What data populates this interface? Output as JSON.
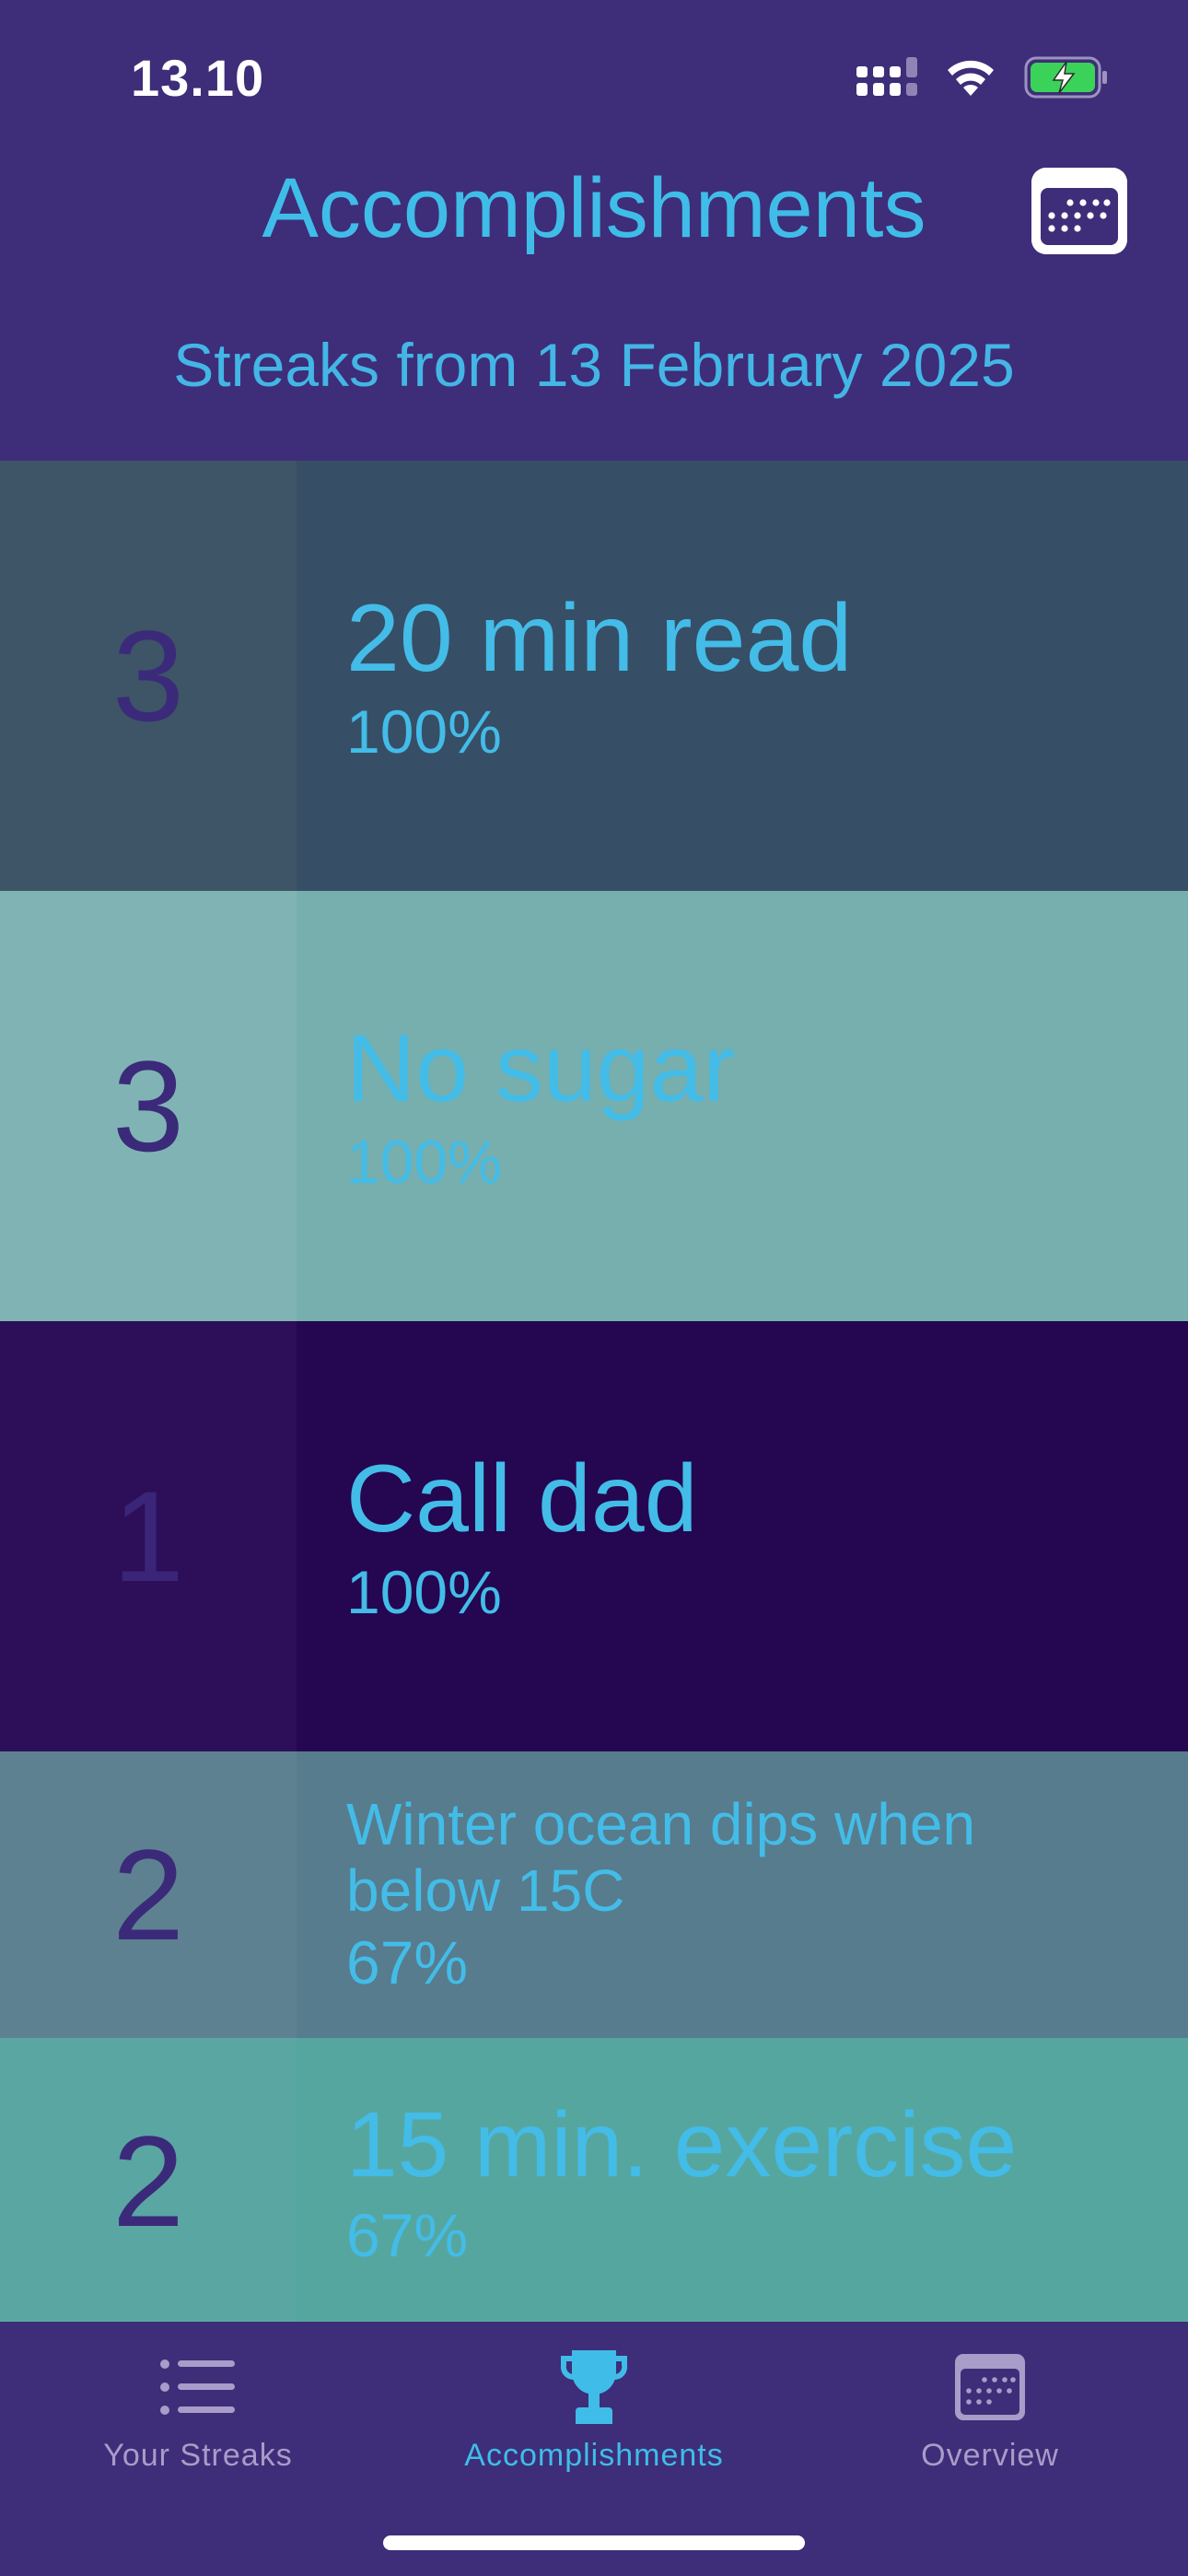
{
  "status": {
    "time": "13.10"
  },
  "header": {
    "title": "Accomplishments",
    "subtitle": "Streaks from 13 February 2025"
  },
  "streaks": [
    {
      "count": "3",
      "title": "20 min read",
      "percent": "100%"
    },
    {
      "count": "3",
      "title": "No sugar",
      "percent": "100%"
    },
    {
      "count": "1",
      "title": "Call dad",
      "percent": "100%"
    },
    {
      "count": "2",
      "title": "Winter ocean dips when below 15C",
      "percent": "67%"
    },
    {
      "count": "2",
      "title": "15 min. exercise",
      "percent": "67%"
    }
  ],
  "tabs": [
    {
      "label": "Your Streaks",
      "icon": "list-icon"
    },
    {
      "label": "Accomplishments",
      "icon": "trophy-icon"
    },
    {
      "label": "Overview",
      "icon": "calendar-icon"
    }
  ],
  "colors": {
    "background": "#3e2d78",
    "accent": "#3fbde8",
    "tab_inactive": "#a89cc8",
    "row_1": "#364f66",
    "row_2": "#77aeae",
    "row_3": "#250651",
    "row_4": "#567c8e",
    "row_5": "#56a6a0"
  }
}
